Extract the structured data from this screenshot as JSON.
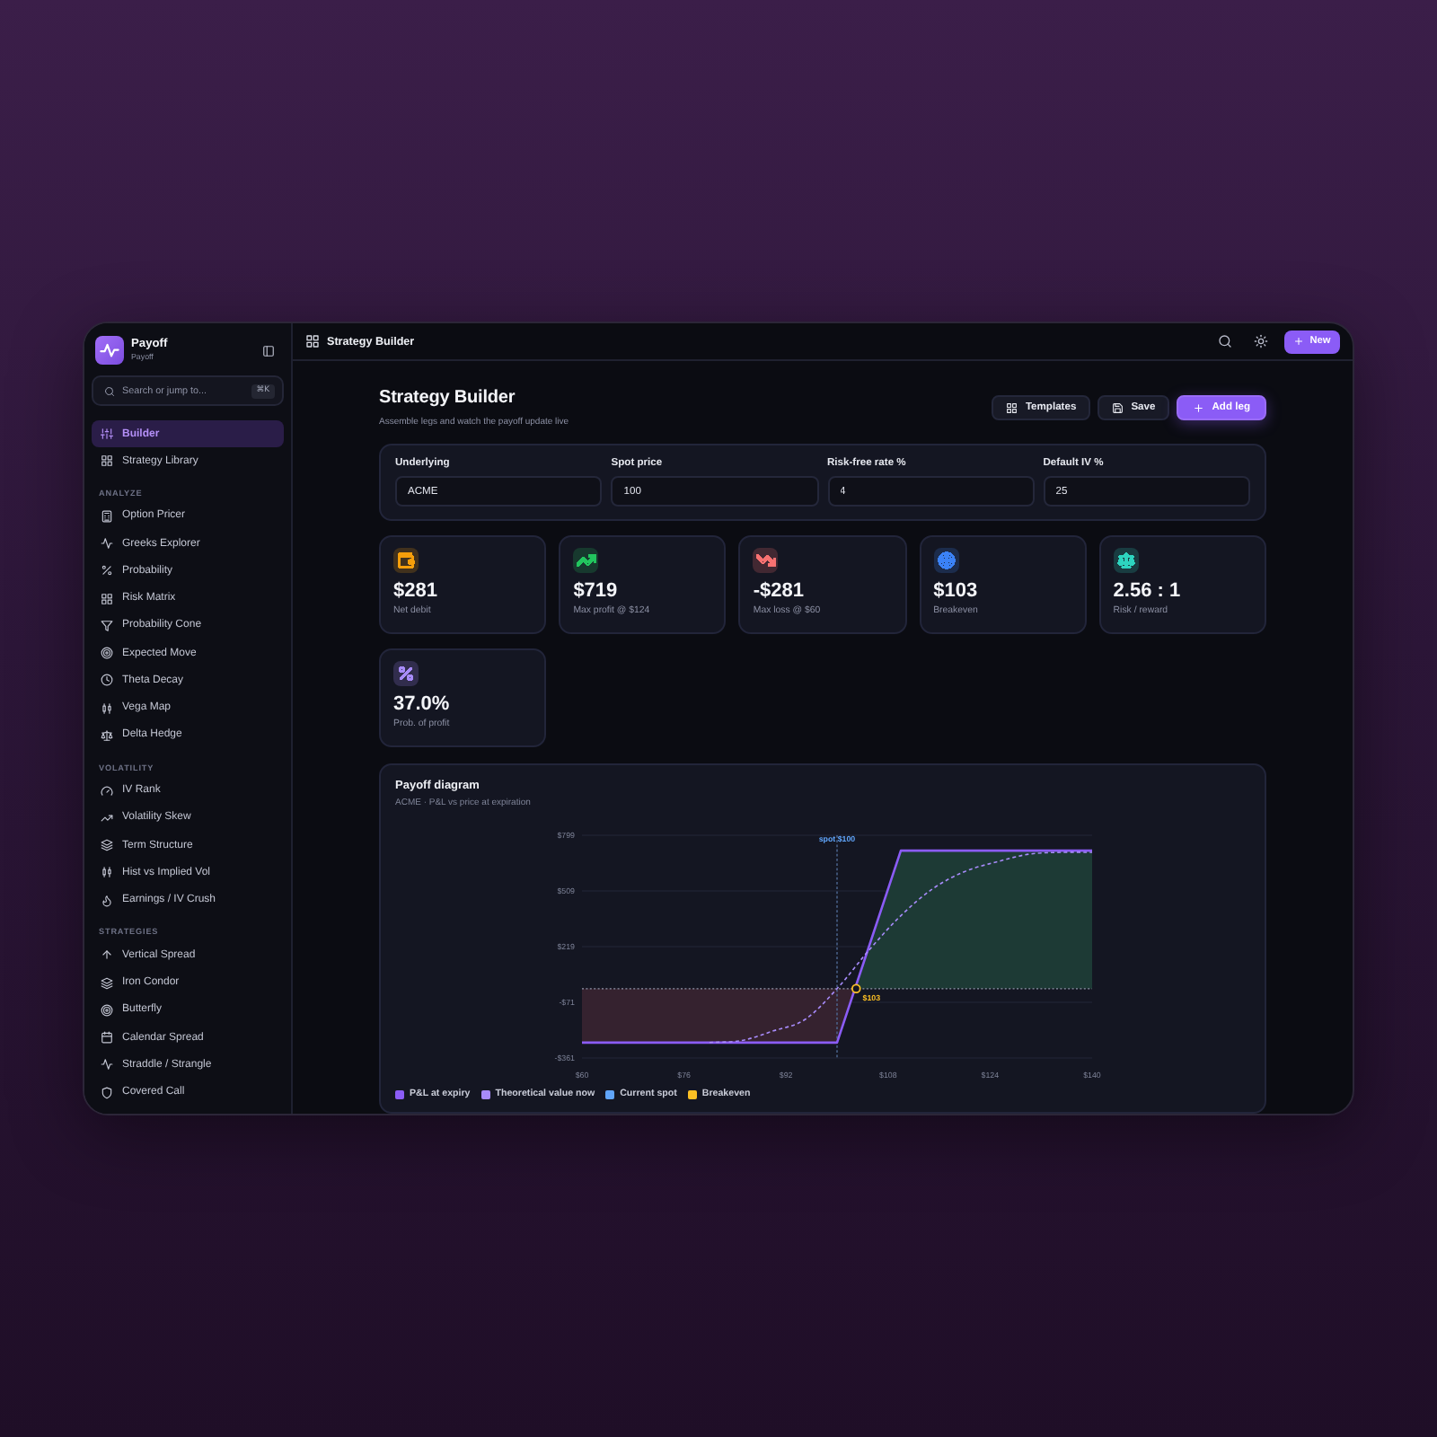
{
  "sidebar": {
    "brand": {
      "name": "Payoff",
      "subtitle": "Payoff"
    },
    "search": {
      "placeholder": "Search or jump to...",
      "shortcut": "⌘K"
    },
    "items": [
      {
        "label": "Builder",
        "selected": true
      },
      {
        "label": "Strategy Library",
        "selected": false
      }
    ],
    "sections": [
      {
        "title": "ANALYZE",
        "items": [
          {
            "label": "Option Pricer",
            "selected": false
          },
          {
            "label": "Greeks Explorer",
            "selected": false
          },
          {
            "label": "Probability",
            "selected": false
          },
          {
            "label": "Risk Matrix",
            "selected": false
          },
          {
            "label": "Probability Cone",
            "selected": false
          },
          {
            "label": "Expected Move",
            "selected": false
          },
          {
            "label": "Theta Decay",
            "selected": false
          },
          {
            "label": "Vega Map",
            "selected": false
          },
          {
            "label": "Delta Hedge",
            "selected": false
          }
        ]
      },
      {
        "title": "VOLATILITY",
        "items": [
          {
            "label": "IV Rank",
            "selected": false
          },
          {
            "label": "Volatility Skew",
            "selected": false
          },
          {
            "label": "Term Structure",
            "selected": false
          },
          {
            "label": "Hist vs Implied Vol",
            "selected": false
          },
          {
            "label": "Earnings / IV Crush",
            "selected": false
          }
        ]
      },
      {
        "title": "STRATEGIES",
        "items": [
          {
            "label": "Vertical Spread",
            "selected": false
          },
          {
            "label": "Iron Condor",
            "selected": false
          },
          {
            "label": "Butterfly",
            "selected": false
          },
          {
            "label": "Calendar Spread",
            "selected": false
          },
          {
            "label": "Straddle / Strangle",
            "selected": false
          },
          {
            "label": "Covered Call",
            "selected": false
          }
        ]
      }
    ]
  },
  "topbar": {
    "title": "Strategy Builder",
    "new_button": "New"
  },
  "header": {
    "title": "Strategy Builder",
    "subtitle": "Assemble legs and watch the payoff update live",
    "buttons": [
      {
        "label": "Templates",
        "kind": "secondary"
      },
      {
        "label": "Save",
        "kind": "secondary"
      },
      {
        "label": "Add leg",
        "kind": "primary"
      }
    ]
  },
  "inputs": [
    {
      "label": "Underlying",
      "value": "ACME"
    },
    {
      "label": "Spot price",
      "value": "100"
    },
    {
      "label": "Risk-free rate %",
      "value": "4"
    },
    {
      "label": "Default IV %",
      "value": "25"
    }
  ],
  "stats": [
    {
      "value": "$281",
      "label": "Net debit",
      "color": "#f59e0b"
    },
    {
      "value": "$719",
      "label": "Max profit @ $124",
      "color": "#22c55e"
    },
    {
      "value": "-$281",
      "label": "Max loss @ $60",
      "color": "#f87171"
    },
    {
      "value": "$103",
      "label": "Breakeven",
      "color": "#3b82f6"
    },
    {
      "value": "2.56 : 1",
      "label": "Risk / reward",
      "color": "#2dd4bf"
    },
    {
      "value": "37.0%",
      "label": "Prob. of profit",
      "color": "#a78bfa"
    }
  ],
  "payoff_chart": {
    "title": "Payoff diagram",
    "subtitle": "ACME · P&L vs price at expiration",
    "chart_data": {
      "type": "line",
      "grid": true,
      "x": [
        60,
        65,
        70,
        75,
        80,
        85,
        90,
        95,
        100,
        105,
        110,
        115,
        120,
        125,
        130,
        135,
        140
      ],
      "xlim": [
        60,
        140
      ],
      "ylim": [
        -361,
        799
      ],
      "xticks": [
        {
          "value": 60,
          "label": "$60"
        },
        {
          "value": 76,
          "label": "$76"
        },
        {
          "value": 92,
          "label": "$92"
        },
        {
          "value": 108,
          "label": "$108"
        },
        {
          "value": 124,
          "label": "$124"
        },
        {
          "value": 140,
          "label": "$140"
        }
      ],
      "yticks": [
        {
          "value": 799,
          "label": "$799"
        },
        {
          "value": 509,
          "label": "$509"
        },
        {
          "value": 219,
          "label": "$219"
        },
        {
          "value": -71,
          "label": "-$71"
        },
        {
          "value": -361,
          "label": "-$361"
        }
      ],
      "series": [
        {
          "name": "P&L at expiry",
          "color": "#8b5cf6",
          "line_style": "solid",
          "values": [
            -281,
            -281,
            -281,
            -281,
            -281,
            -281,
            -281,
            -281,
            -281,
            219,
            719,
            719,
            719,
            719,
            719,
            719,
            719
          ]
        },
        {
          "name": "Theoretical value now",
          "color": "#a78bfa",
          "line_style": "dashed",
          "values": [
            null,
            null,
            null,
            null,
            -280,
            -270,
            -220,
            -160,
            0,
            200,
            380,
            520,
            610,
            660,
            700,
            710,
            710
          ]
        }
      ],
      "ref_lines": [
        {
          "axis": "x",
          "value": 100,
          "label": "spot $100"
        },
        {
          "axis": "y",
          "value": 0
        }
      ],
      "annotations": [
        {
          "x": 103,
          "y": 0,
          "text": "$103"
        }
      ]
    },
    "legend_markers": [
      {
        "label": "Current spot",
        "color": "#60a5fa"
      },
      {
        "label": "Breakeven",
        "color": "#fbbf24"
      }
    ]
  }
}
